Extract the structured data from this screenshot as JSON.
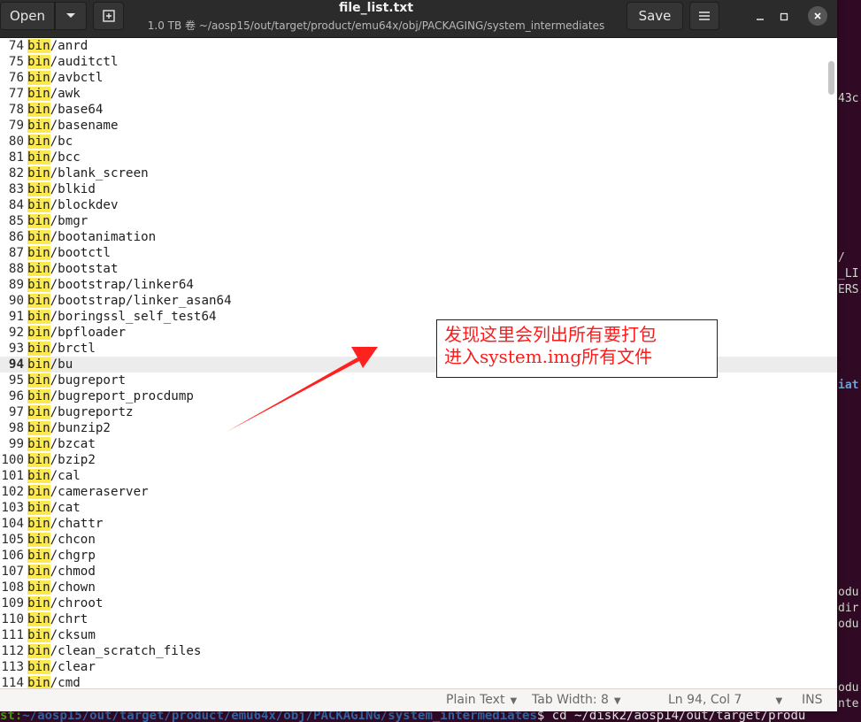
{
  "window": {
    "title": "file_list.txt",
    "subtitle": "1.0 TB 卷 ~/aosp15/out/target/product/emu64x/obj/PACKAGING/system_intermediates",
    "open_label": "Open",
    "save_label": "Save"
  },
  "editor": {
    "current_line": 94,
    "lines": [
      {
        "n": "74",
        "prefix": "bin",
        "rest": "/anrd"
      },
      {
        "n": "75",
        "prefix": "bin",
        "rest": "/auditctl"
      },
      {
        "n": "76",
        "prefix": "bin",
        "rest": "/avbctl"
      },
      {
        "n": "77",
        "prefix": "bin",
        "rest": "/awk"
      },
      {
        "n": "78",
        "prefix": "bin",
        "rest": "/base64"
      },
      {
        "n": "79",
        "prefix": "bin",
        "rest": "/basename"
      },
      {
        "n": "80",
        "prefix": "bin",
        "rest": "/bc"
      },
      {
        "n": "81",
        "prefix": "bin",
        "rest": "/bcc"
      },
      {
        "n": "82",
        "prefix": "bin",
        "rest": "/blank_screen"
      },
      {
        "n": "83",
        "prefix": "bin",
        "rest": "/blkid"
      },
      {
        "n": "84",
        "prefix": "bin",
        "rest": "/blockdev"
      },
      {
        "n": "85",
        "prefix": "bin",
        "rest": "/bmgr"
      },
      {
        "n": "86",
        "prefix": "bin",
        "rest": "/bootanimation"
      },
      {
        "n": "87",
        "prefix": "bin",
        "rest": "/bootctl"
      },
      {
        "n": "88",
        "prefix": "bin",
        "rest": "/bootstat"
      },
      {
        "n": "89",
        "prefix": "bin",
        "rest": "/bootstrap/linker64"
      },
      {
        "n": "90",
        "prefix": "bin",
        "rest": "/bootstrap/linker_asan64"
      },
      {
        "n": "91",
        "prefix": "bin",
        "rest": "/boringssl_self_test64"
      },
      {
        "n": "92",
        "prefix": "bin",
        "rest": "/bpfloader"
      },
      {
        "n": "93",
        "prefix": "bin",
        "rest": "/brctl"
      },
      {
        "n": "94",
        "prefix": "bin",
        "rest": "/bu"
      },
      {
        "n": "95",
        "prefix": "bin",
        "rest": "/bugreport"
      },
      {
        "n": "96",
        "prefix": "bin",
        "rest": "/bugreport_procdump"
      },
      {
        "n": "97",
        "prefix": "bin",
        "rest": "/bugreportz"
      },
      {
        "n": "98",
        "prefix": "bin",
        "rest": "/bunzip2"
      },
      {
        "n": "99",
        "prefix": "bin",
        "rest": "/bzcat"
      },
      {
        "n": "100",
        "prefix": "bin",
        "rest": "/bzip2"
      },
      {
        "n": "101",
        "prefix": "bin",
        "rest": "/cal"
      },
      {
        "n": "102",
        "prefix": "bin",
        "rest": "/cameraserver"
      },
      {
        "n": "103",
        "prefix": "bin",
        "rest": "/cat"
      },
      {
        "n": "104",
        "prefix": "bin",
        "rest": "/chattr"
      },
      {
        "n": "105",
        "prefix": "bin",
        "rest": "/chcon"
      },
      {
        "n": "106",
        "prefix": "bin",
        "rest": "/chgrp"
      },
      {
        "n": "107",
        "prefix": "bin",
        "rest": "/chmod"
      },
      {
        "n": "108",
        "prefix": "bin",
        "rest": "/chown"
      },
      {
        "n": "109",
        "prefix": "bin",
        "rest": "/chroot"
      },
      {
        "n": "110",
        "prefix": "bin",
        "rest": "/chrt"
      },
      {
        "n": "111",
        "prefix": "bin",
        "rest": "/cksum"
      },
      {
        "n": "112",
        "prefix": "bin",
        "rest": "/clean_scratch_files"
      },
      {
        "n": "113",
        "prefix": "bin",
        "rest": "/clear"
      },
      {
        "n": "114",
        "prefix": "bin",
        "rest": "/cmd"
      }
    ]
  },
  "statusbar": {
    "language": "Plain Text",
    "tab_width": "Tab Width: 8",
    "position": "Ln 94, Col 7",
    "mode": "INS"
  },
  "annotation": {
    "line1": "发现这里会列出所有要打包",
    "line2": "进入system.img所有文件",
    "color": "#ff1a1a"
  },
  "terminal": {
    "frag_1": "43c",
    "frag_2": "/",
    "frag_3": "_LI",
    "frag_4": "ERS",
    "frag_5": "iat",
    "frag_6": "odu",
    "frag_7": "dir",
    "frag_8": "odu",
    "frag_9": "odu",
    "frag_10": "nte",
    "bottom_user": "st:",
    "bottom_path": "~/aosp15/out/target/product/emu64x/obj/PACKAGING/system_intermediates",
    "bottom_cmd": "$ cd ~/disk2/aosp14/out/target/produ"
  }
}
